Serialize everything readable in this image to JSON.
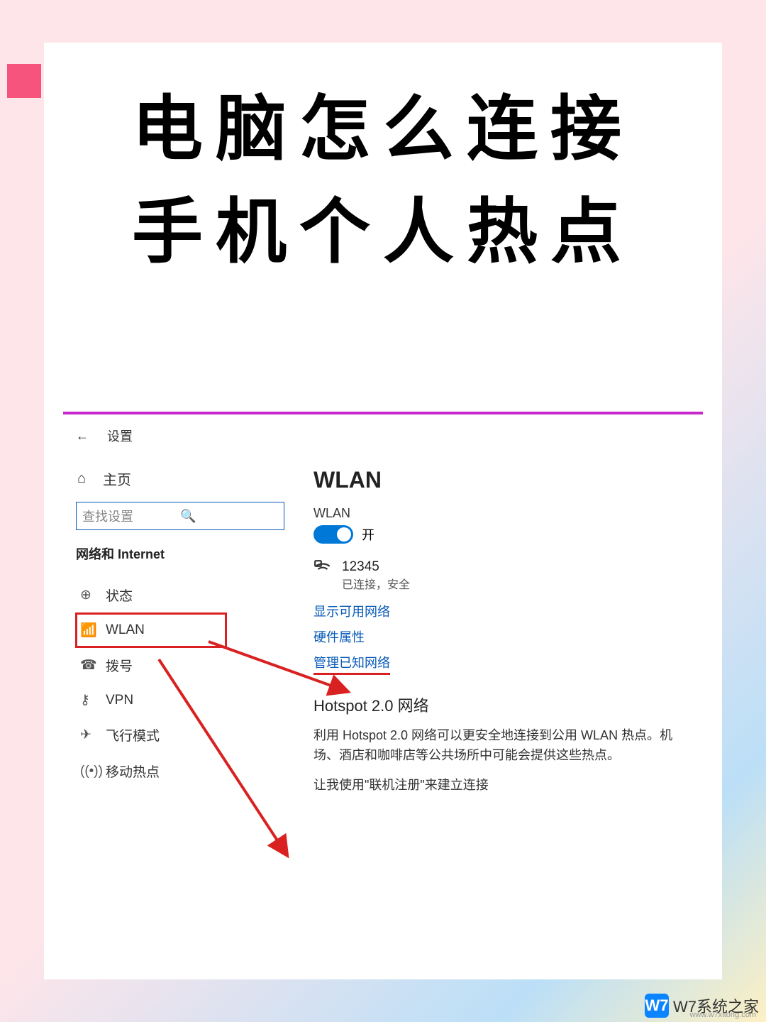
{
  "title_line1": "电脑怎么连接",
  "title_line2": "手机个人热点",
  "window": {
    "back_glyph": "←",
    "title": "设置"
  },
  "sidebar": {
    "home_icon": "⌂",
    "home_label": "主页",
    "search_placeholder": "查找设置",
    "search_icon": "🔍",
    "section": "网络和 Internet",
    "items": [
      {
        "icon": "⊕",
        "label": "状态"
      },
      {
        "icon": "📶",
        "label": "WLAN"
      },
      {
        "icon": "☎",
        "label": "拨号"
      },
      {
        "icon": "⚷",
        "label": "VPN"
      },
      {
        "icon": "✈",
        "label": "飞行模式"
      },
      {
        "icon": "((•))",
        "label": "移动热点"
      }
    ]
  },
  "content": {
    "heading": "WLAN",
    "sublabel": "WLAN",
    "toggle_state": "开",
    "network": {
      "name": "12345",
      "status": "已连接，安全"
    },
    "link_show": "显示可用网络",
    "link_hw": "硬件属性",
    "link_manage": "管理已知网络",
    "hotspot_heading": "Hotspot 2.0 网络",
    "hotspot_body": "利用 Hotspot 2.0 网络可以更安全地连接到公用 WLAN 热点。机场、酒店和咖啡店等公共场所中可能会提供这些热点。",
    "hotspot_body2": "让我使用\"联机注册\"来建立连接"
  },
  "watermark": {
    "logo": "W7",
    "text": "W7系统之家",
    "sub": "www.w7xitong.com"
  }
}
